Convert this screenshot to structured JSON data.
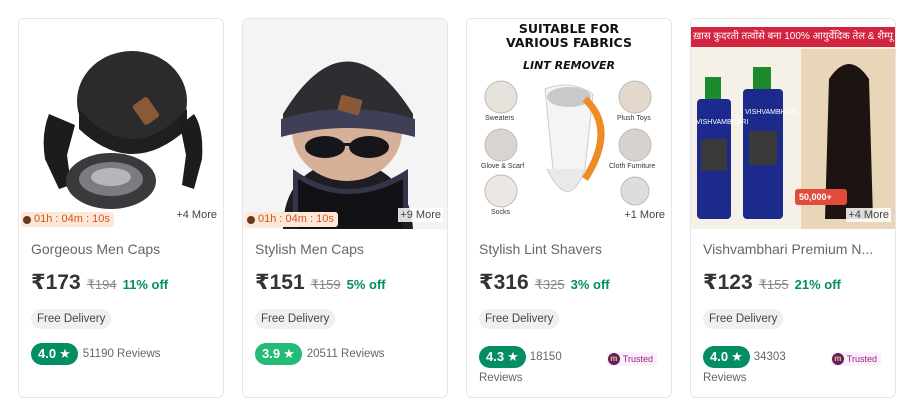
{
  "products": [
    {
      "title": "Gorgeous Men Caps",
      "price": "₹173",
      "mrp": "₹194",
      "discount": "11% off",
      "delivery": "Free Delivery",
      "rating": "4.0",
      "reviews": "51190 Reviews",
      "timer": "01h : 04m : 10s",
      "more": "+4 More",
      "icon": "cap-gloves-scarf-set"
    },
    {
      "title": "Stylish Men Caps",
      "price": "₹151",
      "mrp": "₹159",
      "discount": "5% off",
      "delivery": "Free Delivery",
      "rating": "3.9",
      "reviews": "20511 Reviews",
      "timer": "01h : 04m : 10s",
      "more": "+9 More",
      "icon": "man-wearing-beanie"
    },
    {
      "title": "Stylish Lint Shavers",
      "price": "₹316",
      "mrp": "₹325",
      "discount": "3% off",
      "delivery": "Free Delivery",
      "rating": "4.3",
      "reviews_count": "18150",
      "reviews_word": "Reviews",
      "more": "+1 More",
      "trusted": "Trusted",
      "image_text": {
        "headline_1": "SUITABLE FOR",
        "headline_2": "VARIOUS FABRICS",
        "subhead": "LINT REMOVER",
        "labels": [
          "Sweaters",
          "Plush Toys",
          "Glove & Scarf",
          "Cloth Furniture",
          "Socks"
        ]
      }
    },
    {
      "title": "Vishvambhari Premium N...",
      "price": "₹123",
      "mrp": "₹155",
      "discount": "21% off",
      "delivery": "Free Delivery",
      "rating": "4.0",
      "reviews_count": "34303",
      "reviews_word": "Reviews",
      "more": "+4 More",
      "trusted": "Trusted",
      "image_text": {
        "banner": "ख़ास कुदरती तत्वोंसे बना 100% आयुर्वेदिक तेल & शैम्पू",
        "bottle_1": "VISHVAMBHARI",
        "bottle_2": "VISHVAMBHARI",
        "badge": "50,000+"
      }
    }
  ],
  "colors": {
    "rating_dark": "#038d63",
    "rating_light": "#23bb75",
    "discount": "#038d63",
    "timer_bg": "#fde7d9",
    "trusted": "#9f2089"
  }
}
